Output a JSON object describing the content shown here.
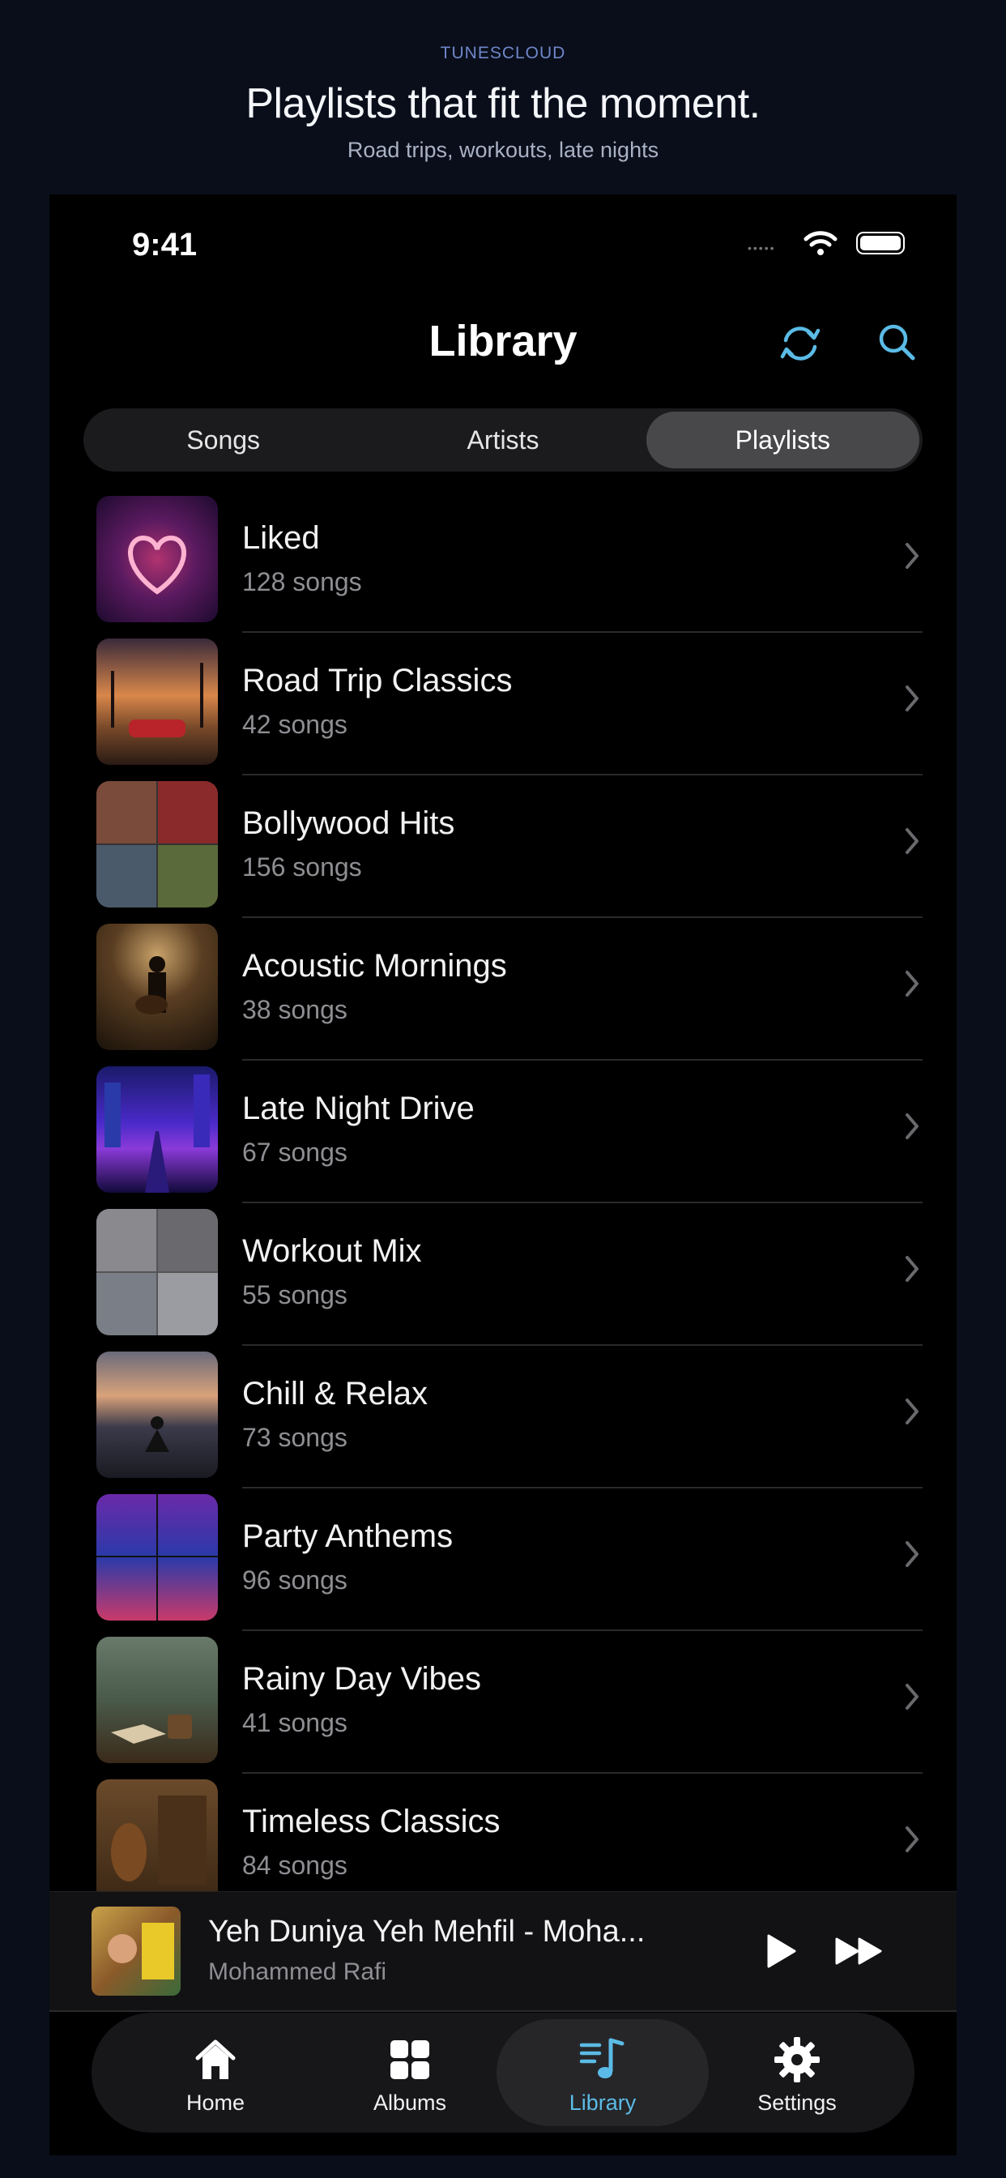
{
  "promo": {
    "brand": "TUNESCLOUD",
    "headline": "Playlists that fit the moment.",
    "subline": "Road trips, workouts, late nights"
  },
  "status_bar": {
    "time": "9:41",
    "dots": "•••••"
  },
  "header": {
    "title": "Library",
    "icons": [
      "sync-icon",
      "search-icon"
    ]
  },
  "segments": [
    {
      "label": "Songs",
      "active": false
    },
    {
      "label": "Artists",
      "active": false
    },
    {
      "label": "Playlists",
      "active": true
    }
  ],
  "playlists": [
    {
      "title": "Liked",
      "count": "128 songs",
      "art": "heart-art"
    },
    {
      "title": "Road Trip Classics",
      "count": "42 songs",
      "art": "sunset-car-art"
    },
    {
      "title": "Bollywood Hits",
      "count": "156 songs",
      "art": "collage-art"
    },
    {
      "title": "Acoustic Mornings",
      "count": "38 songs",
      "art": "guitarist-art"
    },
    {
      "title": "Late Night Drive",
      "count": "67 songs",
      "art": "neon-city-art"
    },
    {
      "title": "Workout Mix",
      "count": "55 songs",
      "art": "gym-collage-art"
    },
    {
      "title": "Chill & Relax",
      "count": "73 songs",
      "art": "meditation-art"
    },
    {
      "title": "Party Anthems",
      "count": "96 songs",
      "art": "concert-art"
    },
    {
      "title": "Rainy Day Vibes",
      "count": "41 songs",
      "art": "rain-coffee-art"
    },
    {
      "title": "Timeless Classics",
      "count": "84 songs",
      "art": "vintage-art"
    }
  ],
  "now_playing": {
    "title": "Yeh Duniya Yeh Mehfil - Moha...",
    "artist": "Mohammed Rafi"
  },
  "tabs": [
    {
      "label": "Home",
      "icon": "home-icon",
      "active": false
    },
    {
      "label": "Albums",
      "icon": "grid-icon",
      "active": false
    },
    {
      "label": "Library",
      "icon": "music-list-icon",
      "active": true
    },
    {
      "label": "Settings",
      "icon": "gear-icon",
      "active": false
    }
  ],
  "colors": {
    "accent": "#5bbbe6",
    "background": "#000000",
    "page": "#090e1a"
  }
}
